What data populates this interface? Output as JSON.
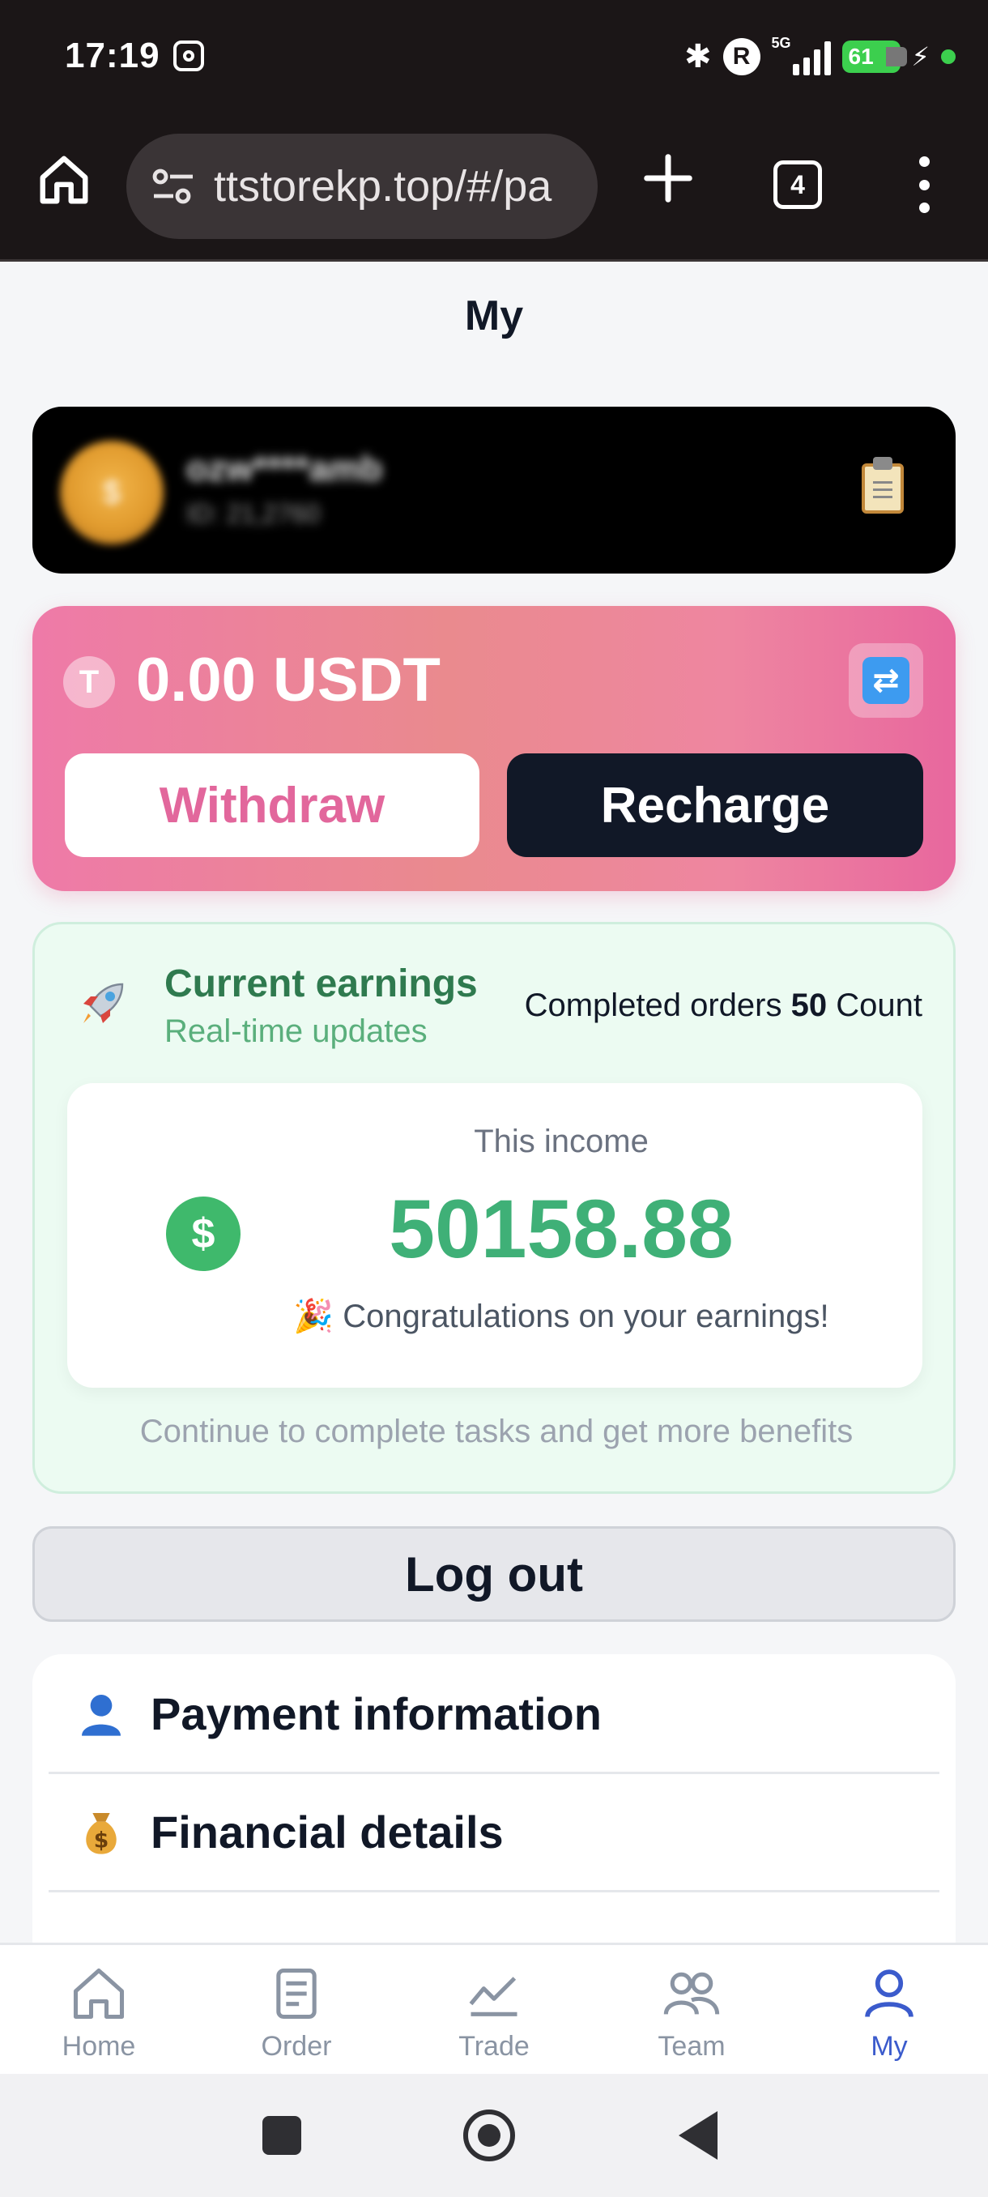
{
  "status_bar": {
    "time": "17:19",
    "network": "5G",
    "battery": "61"
  },
  "browser": {
    "url": "ttstorekp.top/#/pa",
    "tab_count": "4"
  },
  "page": {
    "title": "My"
  },
  "user": {
    "avatar_letter": "$",
    "name": "ozw****amb",
    "id": "ID: 21,2760"
  },
  "balance": {
    "currency_icon": "T",
    "amount": "0.00 USDT",
    "withdraw_label": "Withdraw",
    "recharge_label": "Recharge"
  },
  "earnings": {
    "title": "Current earnings",
    "subtitle": "Real-time updates",
    "completed_prefix": "Completed orders",
    "completed_count": "50",
    "completed_suffix": "Count",
    "income_label": "This income",
    "income_value": "50158.88",
    "dollar_symbol": "$",
    "congrats": "🎉 Congratulations on your earnings!",
    "footer": "Continue to complete tasks and get more benefits"
  },
  "logout_label": "Log out",
  "menu": [
    {
      "label": "Payment information",
      "icon": "person-icon"
    },
    {
      "label": "Financial details",
      "icon": "money-bag-icon"
    }
  ],
  "bottom_nav": [
    {
      "label": "Home",
      "icon": "home-icon",
      "active": false
    },
    {
      "label": "Order",
      "icon": "order-icon",
      "active": false
    },
    {
      "label": "Trade",
      "icon": "trade-icon",
      "active": false
    },
    {
      "label": "Team",
      "icon": "team-icon",
      "active": false
    },
    {
      "label": "My",
      "icon": "user-icon",
      "active": true
    }
  ],
  "colors": {
    "accent_pink": "#e2679c",
    "earn_green": "#3fb077",
    "nav_active": "#3b5bcc"
  }
}
